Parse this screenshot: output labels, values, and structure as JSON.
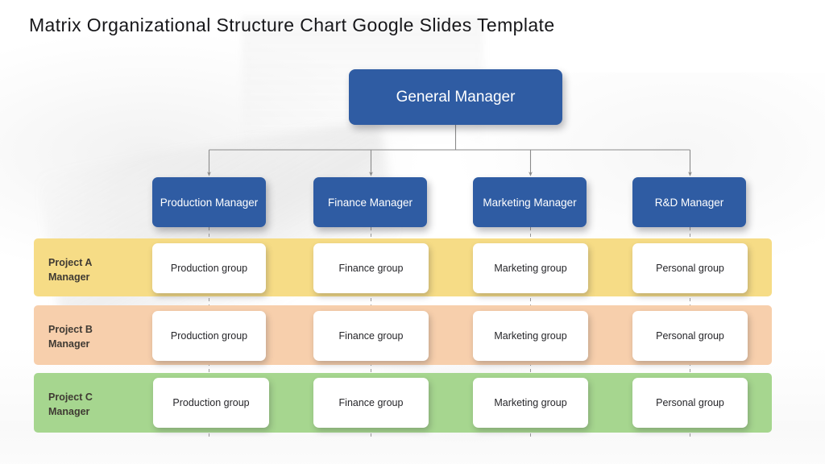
{
  "slide": {
    "title": "Matrix Organizational Structure Chart Google Slides Template",
    "background_color": "#ffffff"
  },
  "colors": {
    "box_blue": "#2f5ca3",
    "box_text": "#ffffff",
    "band_a_yellow": "#f6dc86",
    "band_b_peach": "#f7cfac",
    "band_c_green": "#a6d68f",
    "card_white": "#ffffff",
    "card_text": "#26262a",
    "band_label_text": "#3f3a33",
    "connector_gray": "#8a8a8a",
    "title_text": "#17171a"
  },
  "chart_data": {
    "type": "diagram",
    "diagram_kind": "matrix-organizational-chart",
    "title": "Matrix Organizational Structure Chart Google Slides Template",
    "root": {
      "label": "General Manager"
    },
    "functional_managers": [
      {
        "label": "Production Manager"
      },
      {
        "label": "Finance Manager"
      },
      {
        "label": "Marketing Manager"
      },
      {
        "label": "R&D Manager"
      }
    ],
    "project_rows": [
      {
        "label": "Project A\nManager",
        "label_line1": "Project A",
        "label_line2": "Manager",
        "band_color": "#f6dc86",
        "cells": [
          "Production group",
          "Finance group",
          "Marketing group",
          "Personal group"
        ]
      },
      {
        "label": "Project B\nManager",
        "label_line1": "Project B",
        "label_line2": "Manager",
        "band_color": "#f7cfac",
        "cells": [
          "Production group",
          "Finance group",
          "Marketing group",
          "Personal group"
        ]
      },
      {
        "label": "Project C\nManager",
        "label_line1": "Project C",
        "label_line2": "Manager",
        "band_color": "#a6d68f",
        "cells": [
          "Production group",
          "Finance group",
          "Marketing group",
          "Personal group"
        ]
      }
    ],
    "connectors": {
      "style": "orthogonal-with-arrowheads",
      "root_to_managers": "solid gray lines with down arrowheads",
      "managers_to_rows": "dashed vertical gray lines"
    }
  },
  "org": {
    "general_manager": "General Manager",
    "managers": [
      "Production Manager",
      "Finance Manager",
      "Marketing Manager",
      "R&D Manager"
    ],
    "rows": [
      {
        "line1": "Project A",
        "line2": "Manager",
        "cells": [
          "Production group",
          "Finance group",
          "Marketing group",
          "Personal group"
        ]
      },
      {
        "line1": "Project B",
        "line2": "Manager",
        "cells": [
          "Production group",
          "Finance group",
          "Marketing group",
          "Personal group"
        ]
      },
      {
        "line1": "Project C",
        "line2": "Manager",
        "cells": [
          "Production group",
          "Finance group",
          "Marketing group",
          "Personal group"
        ]
      }
    ]
  }
}
